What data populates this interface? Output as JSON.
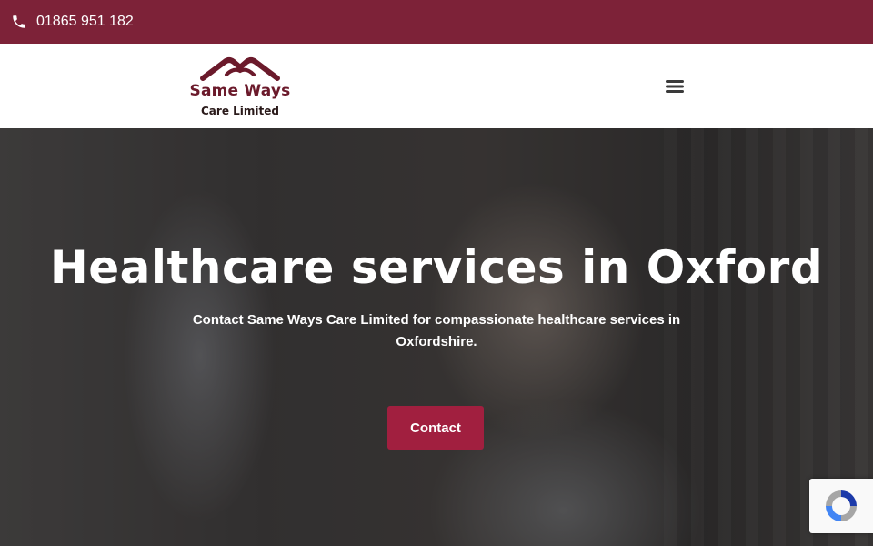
{
  "topbar": {
    "phone": "01865 951 182",
    "phone_icon": "phone-icon",
    "background": "#7d2238"
  },
  "header": {
    "logo": {
      "title": "Same Ways",
      "subtitle": "Care Limited",
      "icon": "roof-hands-icon"
    },
    "menu_icon": "hamburger-menu-icon"
  },
  "hero": {
    "title": "Healthcare services in Oxford",
    "subtitle": "Contact Same Ways Care Limited for compassionate healthcare services in Oxfordshire.",
    "button_label": "Contact",
    "button_color": "#a11f3f"
  },
  "recaptcha": {
    "icon": "recaptcha-icon"
  }
}
